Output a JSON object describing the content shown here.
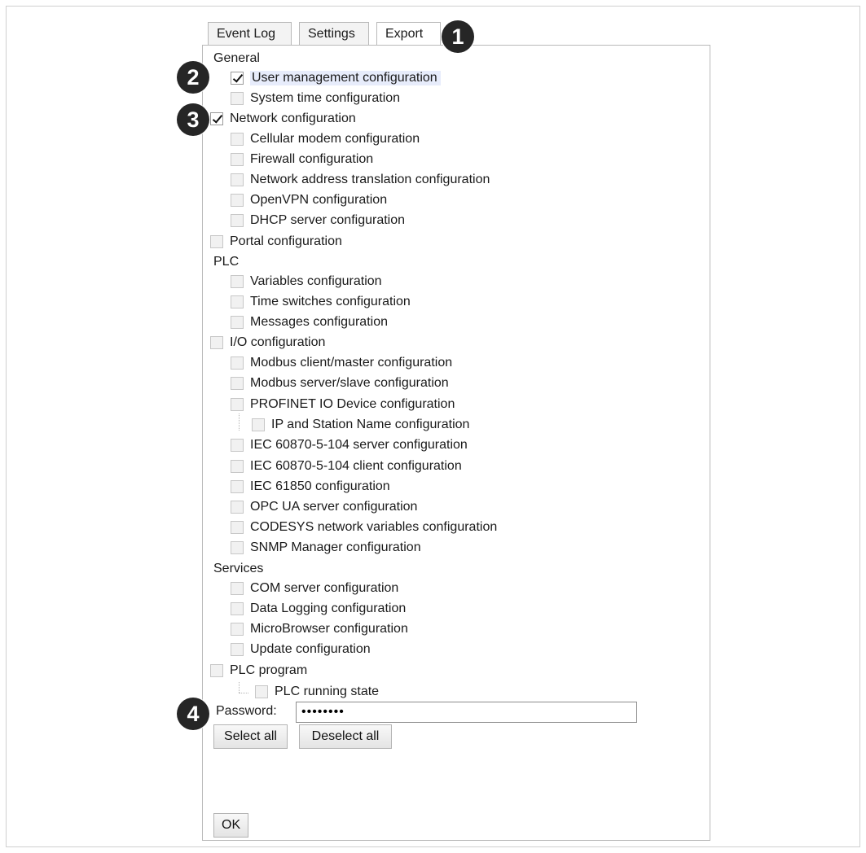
{
  "tabs": [
    {
      "label": "Event Log",
      "active": false
    },
    {
      "label": "Settings",
      "active": false
    },
    {
      "label": "Export",
      "active": true
    }
  ],
  "groups": {
    "general": "General",
    "plc": "PLC",
    "services": "Services"
  },
  "items": {
    "user_mgmt": {
      "label": "User management configuration",
      "checked": true
    },
    "system_time": {
      "label": "System time configuration",
      "checked": false
    },
    "network": {
      "label": "Network configuration",
      "checked": true
    },
    "cellular": {
      "label": "Cellular modem configuration",
      "checked": false
    },
    "firewall": {
      "label": "Firewall configuration",
      "checked": false
    },
    "nat": {
      "label": "Network address translation configuration",
      "checked": false
    },
    "openvpn": {
      "label": "OpenVPN configuration",
      "checked": false
    },
    "dhcp": {
      "label": "DHCP server configuration",
      "checked": false
    },
    "portal": {
      "label": "Portal configuration",
      "checked": false
    },
    "variables": {
      "label": "Variables configuration",
      "checked": false
    },
    "time_switches": {
      "label": "Time switches configuration",
      "checked": false
    },
    "messages": {
      "label": "Messages configuration",
      "checked": false
    },
    "io": {
      "label": "I/O configuration",
      "checked": false
    },
    "modbus_client": {
      "label": "Modbus client/master configuration",
      "checked": false
    },
    "modbus_server": {
      "label": "Modbus server/slave configuration",
      "checked": false
    },
    "profinet": {
      "label": "PROFINET IO Device configuration",
      "checked": false
    },
    "ip_station": {
      "label": "IP and Station Name configuration",
      "checked": false
    },
    "iec104_server": {
      "label": "IEC 60870-5-104 server configuration",
      "checked": false
    },
    "iec104_client": {
      "label": "IEC 60870-5-104 client configuration",
      "checked": false
    },
    "iec61850": {
      "label": "IEC 61850 configuration",
      "checked": false
    },
    "opcua": {
      "label": "OPC UA server configuration",
      "checked": false
    },
    "codesys": {
      "label": "CODESYS network variables configuration",
      "checked": false
    },
    "snmp": {
      "label": "SNMP Manager configuration",
      "checked": false
    },
    "com_server": {
      "label": "COM server configuration",
      "checked": false
    },
    "data_logging": {
      "label": "Data Logging configuration",
      "checked": false
    },
    "microbrowser": {
      "label": "MicroBrowser configuration",
      "checked": false
    },
    "update": {
      "label": "Update configuration",
      "checked": false
    },
    "plc_program": {
      "label": "PLC program",
      "checked": false
    },
    "plc_running": {
      "label": "PLC running state",
      "checked": false
    }
  },
  "buttons": {
    "select_all": "Select all",
    "deselect_all": "Deselect all",
    "ok": "OK"
  },
  "password": {
    "label": "Password:",
    "value": "••••••••"
  },
  "callouts": [
    "1",
    "2",
    "3",
    "4"
  ]
}
